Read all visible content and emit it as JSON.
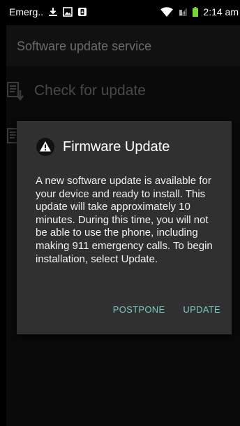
{
  "status_bar": {
    "carrier": "Emerg..",
    "time": "2:14 am"
  },
  "app": {
    "title": "Software update service",
    "menu_items": [
      {
        "label": "Check for update",
        "icon": "download-document-icon"
      },
      {
        "label": "",
        "icon": "document-icon"
      }
    ]
  },
  "dialog": {
    "icon": "warning-icon",
    "title": "Firmware Update",
    "message": "A new software update is available for your device and ready to install. This update will take approximately 10 minutes. During this time, you will not be able to use the phone, including making 911 emergency calls. To begin installation, select Update.",
    "postpone_label": "POSTPONE",
    "update_label": "UPDATE"
  },
  "colors": {
    "dialog_bg": "#303030",
    "button_text": "#7fc9c4",
    "battery": "#7bd43a"
  }
}
